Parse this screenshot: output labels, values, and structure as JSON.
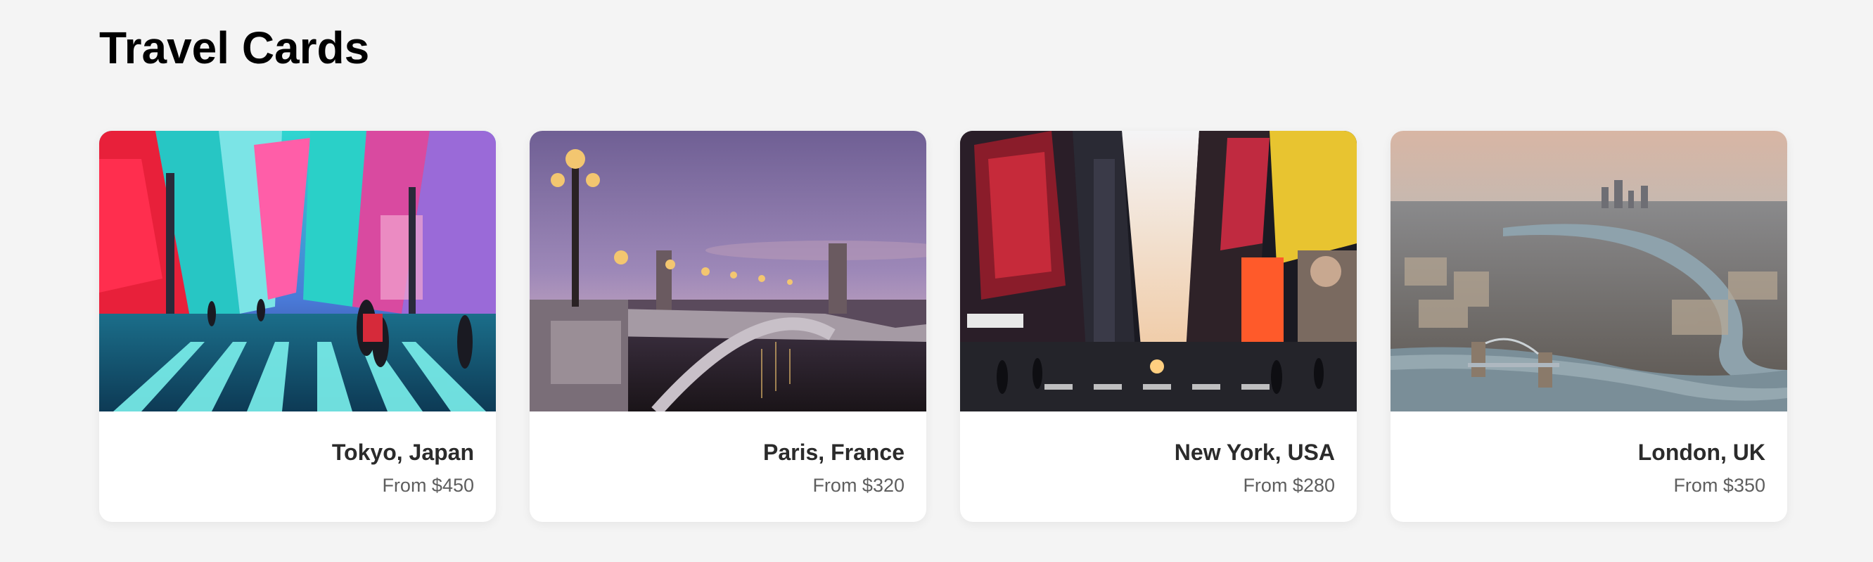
{
  "header": {
    "title": "Travel Cards"
  },
  "cards": [
    {
      "title": "Tokyo, Japan",
      "price": "From $450",
      "image_icon": "tokyo-street-photo"
    },
    {
      "title": "Paris, France",
      "price": "From $320",
      "image_icon": "paris-bridge-photo"
    },
    {
      "title": "New York, USA",
      "price": "From $280",
      "image_icon": "times-square-photo"
    },
    {
      "title": "London, UK",
      "price": "From $350",
      "image_icon": "london-aerial-photo"
    }
  ],
  "colors": {
    "background": "#f4f4f4",
    "card": "#ffffff",
    "title_text": "#2b2b2b",
    "price_text": "#5e5e5e"
  }
}
